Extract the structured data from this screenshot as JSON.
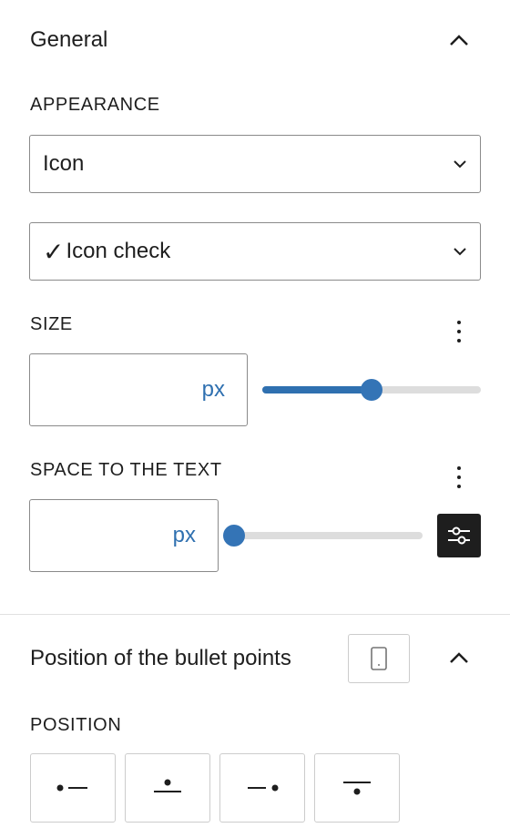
{
  "general": {
    "title": "General",
    "appearance_label": "APPEARANCE",
    "appearance_select": "Icon",
    "icon_select": {
      "glyph": "✓",
      "text": "Icon check"
    },
    "size": {
      "label": "SIZE",
      "unit": "px",
      "value": "",
      "slider_fraction": 0.5
    },
    "spacing": {
      "label": "SPACE TO THE TEXT",
      "unit": "px",
      "value": "",
      "slider_fraction": 0.0
    }
  },
  "bullets": {
    "title": "Position of the bullet points",
    "position_label": "POSITION",
    "options": [
      "left",
      "top",
      "right",
      "bottom"
    ]
  },
  "colors": {
    "accent": "#2f70b0",
    "dark_button": "#1e1e1e"
  },
  "icons": [
    "chevron-up-icon",
    "chevron-down-icon",
    "kebab-menu-icon",
    "sliders-icon",
    "tablet-icon"
  ]
}
